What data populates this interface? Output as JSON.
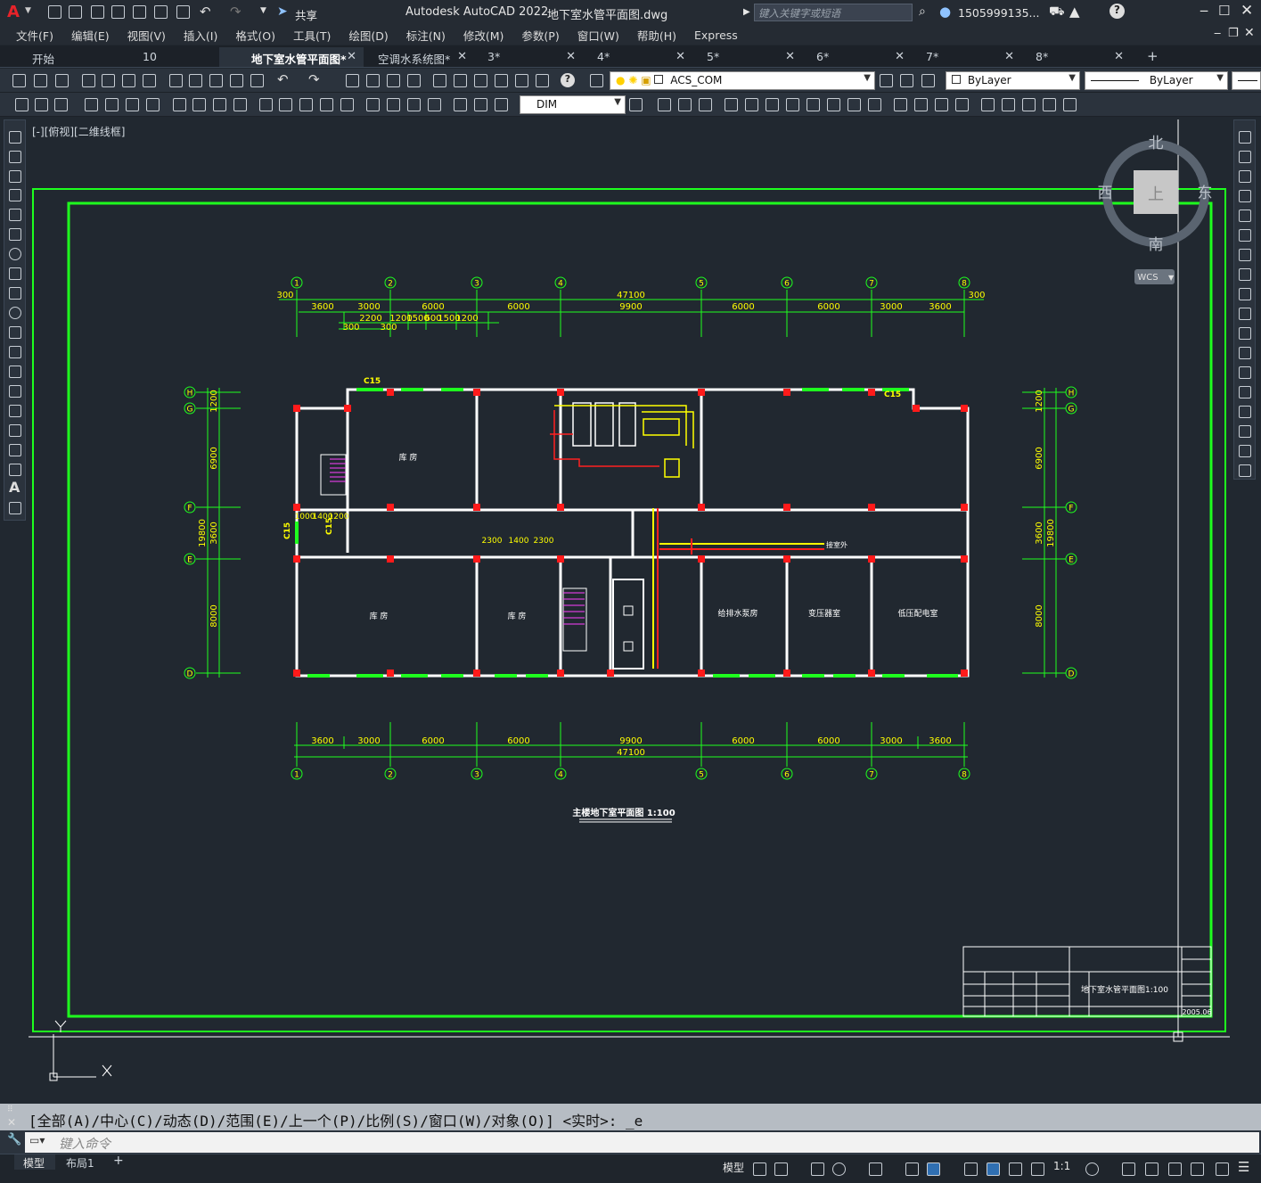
{
  "title_bar": {
    "app_title": "Autodesk AutoCAD 2022",
    "doc_title": "地下室水管平面图.dwg",
    "share_label": "共享",
    "search_placeholder": "键入关键字或短语",
    "user": "1505999135..."
  },
  "menu": [
    "文件(F)",
    "编辑(E)",
    "视图(V)",
    "插入(I)",
    "格式(O)",
    "工具(T)",
    "绘图(D)",
    "标注(N)",
    "修改(M)",
    "参数(P)",
    "窗口(W)",
    "帮助(H)",
    "Express"
  ],
  "tabs": [
    {
      "label": "开始",
      "active": false,
      "close": false
    },
    {
      "label": "10",
      "active": false,
      "close": true
    },
    {
      "label": "地下室水管平面图*",
      "active": true,
      "close": true
    },
    {
      "label": "空调水系统图*",
      "active": false,
      "close": true
    },
    {
      "label": "3*",
      "active": false,
      "close": true
    },
    {
      "label": "4*",
      "active": false,
      "close": true
    },
    {
      "label": "5*",
      "active": false,
      "close": true
    },
    {
      "label": "6*",
      "active": false,
      "close": true
    },
    {
      "label": "7*",
      "active": false,
      "close": true
    },
    {
      "label": "8*",
      "active": false,
      "close": true
    }
  ],
  "toolbar": {
    "layer_combo": "ACS_COM",
    "color_combo": "ByLayer",
    "linetype_combo": "ByLayer",
    "dimstyle_combo": "DIM"
  },
  "viewport": {
    "label": "[-][俯视][二维线框]",
    "viewcube": {
      "north": "北",
      "south": "南",
      "east": "东",
      "west": "西",
      "face": "上",
      "wcs": "WCS"
    }
  },
  "drawing": {
    "grid_numbers": [
      "1",
      "2",
      "3",
      "4",
      "5",
      "6",
      "7",
      "8"
    ],
    "grid_letters_left": [
      "H",
      "G",
      "F",
      "E",
      "D"
    ],
    "top_dims_total": "47100",
    "top_dims_row2": [
      "3600",
      "3000",
      "6000",
      "6000",
      "9900",
      "6000",
      "6000",
      "3000",
      "3600"
    ],
    "top_dims_row3": [
      "2200",
      "1200",
      "1500",
      "600",
      "1500",
      "1200"
    ],
    "top_dims_small": [
      "300",
      "300",
      "300",
      "300"
    ],
    "bottom_dims_row1": [
      "3600",
      "3000",
      "6000",
      "6000",
      "9900",
      "6000",
      "6000",
      "3000",
      "3600"
    ],
    "bottom_dims_total": "47100",
    "left_dims": [
      "1200",
      "6900",
      "3600",
      "19800",
      "8000"
    ],
    "right_dims": [
      "1200",
      "6900",
      "3600",
      "19800",
      "8000"
    ],
    "corridor_dims": [
      "2300",
      "1400",
      "2300"
    ],
    "stair_dims": [
      "1000",
      "1400",
      "1200"
    ],
    "window_tags": [
      "C15",
      "C15",
      "C15",
      "C15"
    ],
    "room_labels": [
      "库 房",
      "库 房",
      "库 房",
      "给排水泵房",
      "变压器室",
      "低压配电室"
    ],
    "pipe_label": "接室外",
    "drawing_title": "主楼地下室平面图 1:100",
    "title_block": {
      "drawing_name": "地下室水管平面图1:100",
      "date": "2005.06"
    }
  },
  "command": {
    "history": "[全部(A)/中心(C)/动态(D)/范围(E)/上一个(P)/比例(S)/窗口(W)/对象(O)] <实时>: _e",
    "input_placeholder": "键入命令"
  },
  "status": {
    "model_tab": "模型",
    "layout_tab": "布局1",
    "model_button": "模型",
    "scale": "1:1"
  },
  "colors": {
    "background": "#212830",
    "drawing_green": "#1eff1e",
    "wall": "#ffffff",
    "column": "#ff1a1a",
    "pipe_yellow": "#ffff00"
  }
}
